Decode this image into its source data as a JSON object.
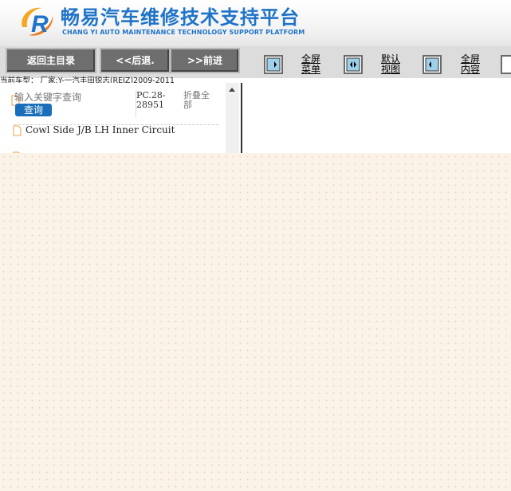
{
  "header": {
    "title_cn": "畅易汽车维修技术支持平台",
    "title_en": "CHANG YI AUTO MAINTENANCE TECHNOLOGY SUPPORT PLATFORM",
    "logo_letter": "R"
  },
  "toolbar": {
    "back_main_label": "返回主目录",
    "back_label": "<<后退.",
    "forward_label": ">>前进",
    "fullscreen_menu_line1": "全屏",
    "fullscreen_menu_line2": "菜单",
    "default_view_line1": "默认",
    "default_view_line2": "视图",
    "fullscreen_content_line1": "全屏",
    "fullscreen_content_line2": "内容"
  },
  "car_info": "当前车型：  厂家:Y-一汽丰田锐志(REIZ)2009-2011",
  "search": {
    "placeholder": "输入关键字查询",
    "button_label": "查询"
  },
  "doc": {
    "code": "PC.28-28951",
    "collapse_all": "折叠全部"
  },
  "tree": {
    "items": [
      {
        "label": "Cowl Side J/B LH Inner Circuit",
        "icon": "document-icon"
      },
      {
        "label": "",
        "icon": "document-icon"
      }
    ]
  },
  "colors": {
    "brand_blue": "#1f74c8",
    "nav_button": "#6e6e6e",
    "search_button": "#1b6fba",
    "overlay": "#fcf3e8"
  }
}
